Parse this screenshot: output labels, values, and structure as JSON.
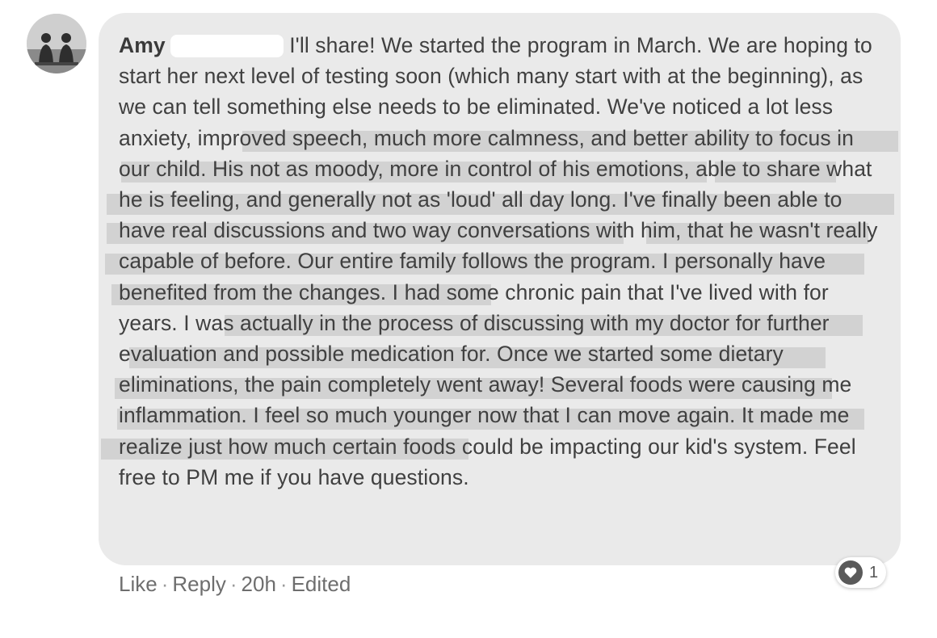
{
  "comment": {
    "author_name": "Amy",
    "paragraph": "I'll share! We started the program in March. We are hoping to start her next level of testing soon (which many start with at the beginning), as we can tell something else needs to be eliminated. We've noticed a lot less anxiety, improved speech, much more calmness, and better ability to focus in our child. His not as moody, more in control of his emotions, able to share what he is feeling, and generally not as 'loud' all day long. I've finally been able to have real discussions and two way conversations with him, that he wasn't really capable of before. Our entire family follows the program. I personally have benefited from the changes. I had some chronic pain that I've lived with for years. I was actually in the process of discussing with my doctor for further evaluation and possible medication for. Once we started some dietary eliminations, the pain completely went away! Several foods were causing me inflammation. I feel so much younger now that I can move again. It made me realize just how much certain foods could be impacting our kid's system. Feel free to PM me if you have questions."
  },
  "actions": {
    "like": "Like",
    "reply": "Reply",
    "time": "20h",
    "edited": "Edited",
    "separator": "·"
  },
  "reaction": {
    "icon": "heart-icon",
    "count": "1"
  },
  "colors": {
    "bubble": "#eaeaea",
    "highlight": "#d2d2d2",
    "text": "#404040",
    "meta": "#6e6e6e"
  }
}
